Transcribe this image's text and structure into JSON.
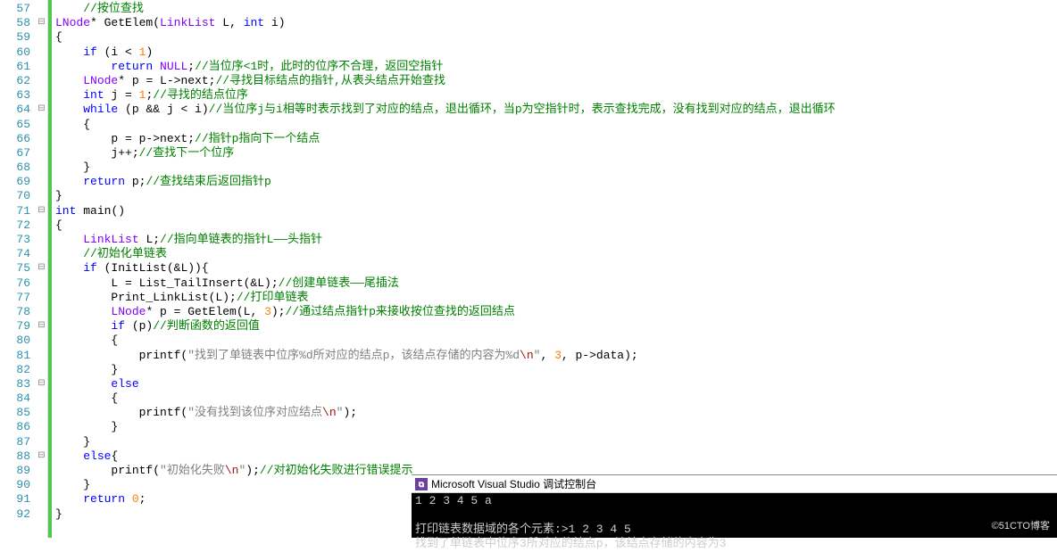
{
  "lines": {
    "start": 57,
    "end": 92
  },
  "fold": {
    "58": "⊟",
    "64": "⊟",
    "71": "⊟",
    "75": "⊟",
    "79": "⊟",
    "83": "⊟",
    "88": "⊟"
  },
  "code": {
    "57": [
      {
        "t": "    ",
        "c": "id"
      },
      {
        "t": "//按位查找",
        "c": "cm"
      }
    ],
    "58": [
      {
        "t": "LNode",
        "c": "type"
      },
      {
        "t": "* ",
        "c": "id"
      },
      {
        "t": "GetElem",
        "c": "id"
      },
      {
        "t": "(",
        "c": "id"
      },
      {
        "t": "LinkList",
        "c": "type"
      },
      {
        "t": " L, ",
        "c": "id"
      },
      {
        "t": "int",
        "c": "kw"
      },
      {
        "t": " i)",
        "c": "id"
      }
    ],
    "59": [
      {
        "t": "{",
        "c": "id"
      }
    ],
    "60": [
      {
        "t": "    ",
        "c": "id"
      },
      {
        "t": "if",
        "c": "kw"
      },
      {
        "t": " (i < ",
        "c": "id"
      },
      {
        "t": "1",
        "c": "num"
      },
      {
        "t": ")",
        "c": "id"
      }
    ],
    "61": [
      {
        "t": "        ",
        "c": "id"
      },
      {
        "t": "return",
        "c": "kw"
      },
      {
        "t": " ",
        "c": "id"
      },
      {
        "t": "NULL",
        "c": "type"
      },
      {
        "t": ";",
        "c": "id"
      },
      {
        "t": "//当位序<1时，此时的位序不合理，返回空指针",
        "c": "cm"
      }
    ],
    "62": [
      {
        "t": "    ",
        "c": "id"
      },
      {
        "t": "LNode",
        "c": "type"
      },
      {
        "t": "* p = L->next;",
        "c": "id"
      },
      {
        "t": "//寻找目标结点的指针,从表头结点开始查找",
        "c": "cm"
      }
    ],
    "63": [
      {
        "t": "    ",
        "c": "id"
      },
      {
        "t": "int",
        "c": "kw"
      },
      {
        "t": " j = ",
        "c": "id"
      },
      {
        "t": "1",
        "c": "num"
      },
      {
        "t": ";",
        "c": "id"
      },
      {
        "t": "//寻找的结点位序",
        "c": "cm"
      }
    ],
    "64": [
      {
        "t": "    ",
        "c": "id"
      },
      {
        "t": "while",
        "c": "kw"
      },
      {
        "t": " (p && j < i)",
        "c": "id"
      },
      {
        "t": "//当位序j与i相等时表示找到了对应的结点，退出循环，当p为空指针时，表示查找完成，没有找到对应的结点，退出循环",
        "c": "cm"
      }
    ],
    "65": [
      {
        "t": "    {",
        "c": "id"
      }
    ],
    "66": [
      {
        "t": "        p = p->next;",
        "c": "id"
      },
      {
        "t": "//指针p指向下一个结点",
        "c": "cm"
      }
    ],
    "67": [
      {
        "t": "        j++;",
        "c": "id"
      },
      {
        "t": "//查找下一个位序",
        "c": "cm"
      }
    ],
    "68": [
      {
        "t": "    }",
        "c": "id"
      }
    ],
    "69": [
      {
        "t": "    ",
        "c": "id"
      },
      {
        "t": "return",
        "c": "kw"
      },
      {
        "t": " p;",
        "c": "id"
      },
      {
        "t": "//查找结束后返回指针p",
        "c": "cm"
      }
    ],
    "70": [
      {
        "t": "}",
        "c": "id"
      }
    ],
    "71": [
      {
        "t": "int",
        "c": "kw"
      },
      {
        "t": " ",
        "c": "id"
      },
      {
        "t": "main",
        "c": "fn"
      },
      {
        "t": "()",
        "c": "id"
      }
    ],
    "72": [
      {
        "t": "{",
        "c": "id"
      }
    ],
    "73": [
      {
        "t": "    ",
        "c": "id"
      },
      {
        "t": "LinkList",
        "c": "type"
      },
      {
        "t": " L;",
        "c": "id"
      },
      {
        "t": "//指向单链表的指针L——头指针",
        "c": "cm"
      }
    ],
    "74": [
      {
        "t": "    ",
        "c": "id"
      },
      {
        "t": "//初始化单链表",
        "c": "cm"
      }
    ],
    "75": [
      {
        "t": "    ",
        "c": "id"
      },
      {
        "t": "if",
        "c": "kw"
      },
      {
        "t": " (InitList(&L)){",
        "c": "id"
      }
    ],
    "76": [
      {
        "t": "        L = List_TailInsert(&L);",
        "c": "id"
      },
      {
        "t": "//创建单链表——尾插法",
        "c": "cm"
      }
    ],
    "77": [
      {
        "t": "        Print_LinkList(L);",
        "c": "id"
      },
      {
        "t": "//打印单链表",
        "c": "cm"
      }
    ],
    "78": [
      {
        "t": "        ",
        "c": "id"
      },
      {
        "t": "LNode",
        "c": "type"
      },
      {
        "t": "* p = GetElem(L, ",
        "c": "id"
      },
      {
        "t": "3",
        "c": "num"
      },
      {
        "t": ");",
        "c": "id"
      },
      {
        "t": "//通过结点指针p来接收按位查找的返回结点",
        "c": "cm"
      }
    ],
    "79": [
      {
        "t": "        ",
        "c": "id"
      },
      {
        "t": "if",
        "c": "kw"
      },
      {
        "t": " (p)",
        "c": "id"
      },
      {
        "t": "//判断函数的返回值",
        "c": "cm"
      }
    ],
    "80": [
      {
        "t": "        {",
        "c": "id"
      }
    ],
    "81": [
      {
        "t": "            printf(",
        "c": "id"
      },
      {
        "t": "\"找到了单链表中位序%d所对应的结点p，该结点存储的内容为%d",
        "c": "str"
      },
      {
        "t": "\\n",
        "c": "esc"
      },
      {
        "t": "\"",
        "c": "str"
      },
      {
        "t": ", ",
        "c": "id"
      },
      {
        "t": "3",
        "c": "num"
      },
      {
        "t": ", p->data);",
        "c": "id"
      }
    ],
    "82": [
      {
        "t": "        }",
        "c": "id"
      }
    ],
    "83": [
      {
        "t": "        ",
        "c": "id"
      },
      {
        "t": "else",
        "c": "kw"
      }
    ],
    "84": [
      {
        "t": "        {",
        "c": "id"
      }
    ],
    "85": [
      {
        "t": "            printf(",
        "c": "id"
      },
      {
        "t": "\"没有找到该位序对应结点",
        "c": "str"
      },
      {
        "t": "\\n",
        "c": "esc"
      },
      {
        "t": "\"",
        "c": "str"
      },
      {
        "t": ");",
        "c": "id"
      }
    ],
    "86": [
      {
        "t": "        }",
        "c": "id"
      }
    ],
    "87": [
      {
        "t": "    }",
        "c": "id"
      }
    ],
    "88": [
      {
        "t": "    ",
        "c": "id"
      },
      {
        "t": "else",
        "c": "kw"
      },
      {
        "t": "{",
        "c": "id"
      }
    ],
    "89": [
      {
        "t": "        printf(",
        "c": "id"
      },
      {
        "t": "\"初始化失败",
        "c": "str"
      },
      {
        "t": "\\n",
        "c": "esc"
      },
      {
        "t": "\"",
        "c": "str"
      },
      {
        "t": ");",
        "c": "id"
      },
      {
        "t": "//对初始化失败进行错误提示",
        "c": "cm"
      }
    ],
    "90": [
      {
        "t": "    }",
        "c": "id"
      }
    ],
    "91": [
      {
        "t": "    ",
        "c": "id"
      },
      {
        "t": "return",
        "c": "kw"
      },
      {
        "t": " ",
        "c": "id"
      },
      {
        "t": "0",
        "c": "num"
      },
      {
        "t": ";",
        "c": "id"
      }
    ],
    "92": [
      {
        "t": "}",
        "c": "id"
      }
    ]
  },
  "console": {
    "title": "Microsoft Visual Studio 调试控制台",
    "l1": "1 2 3 4 5 a",
    "l2": "打印链表数据域的各个元素:>1 2 3 4 5",
    "l3": "找到了单链表中位序3所对应的结点p，该结点存储的内容为3"
  },
  "watermark": "©51CTO博客"
}
